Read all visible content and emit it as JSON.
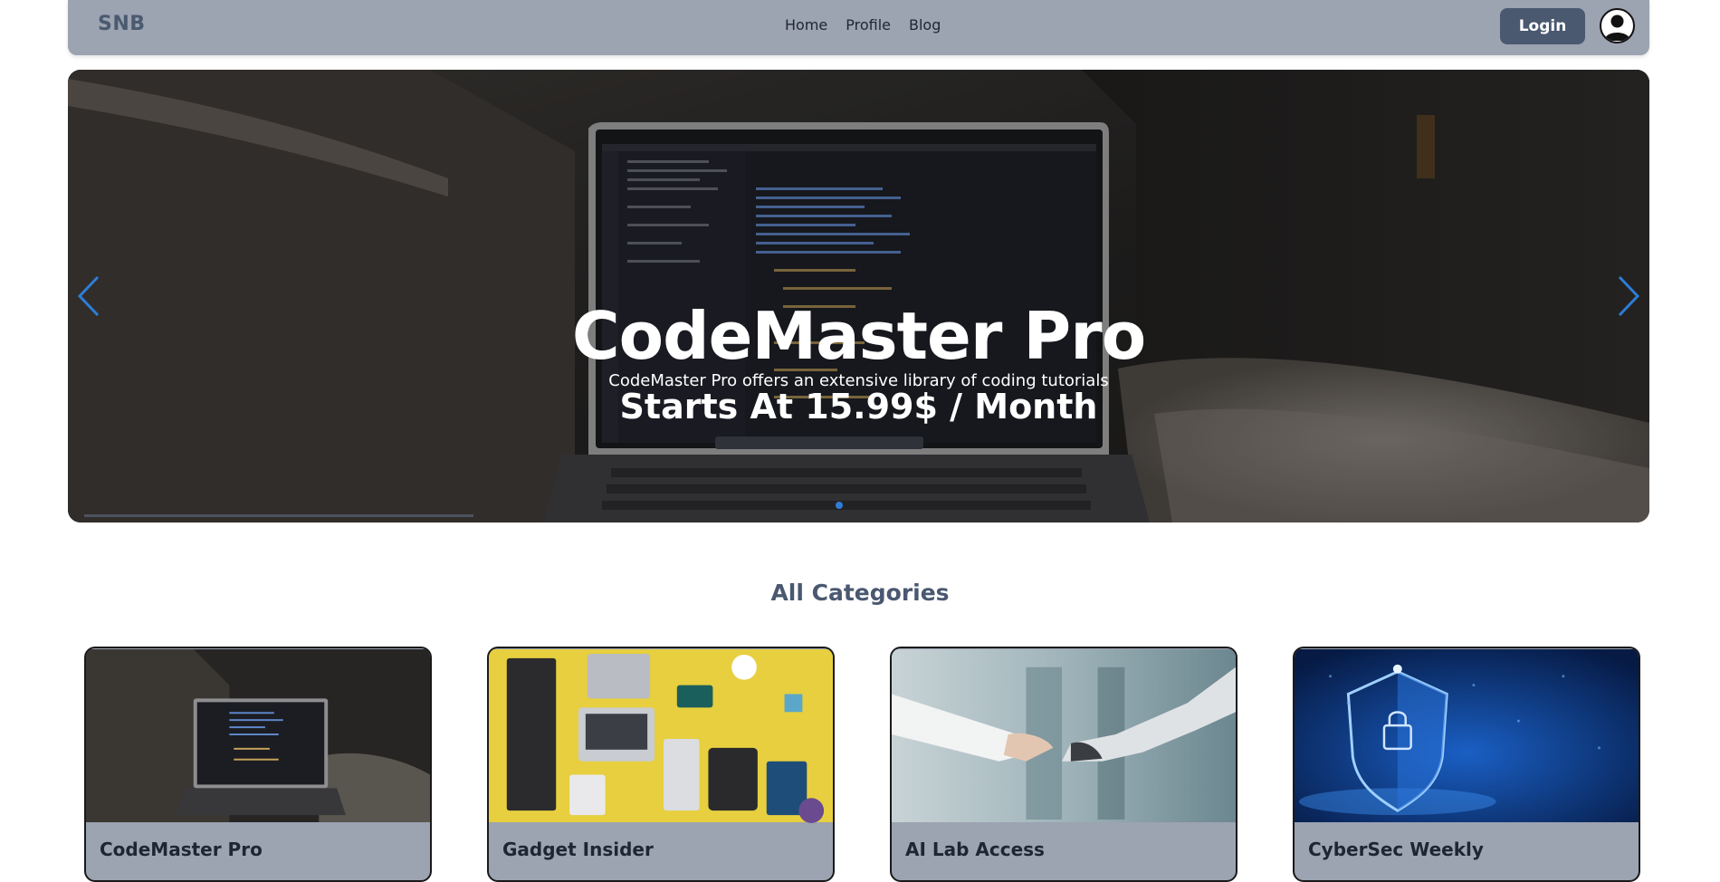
{
  "navbar": {
    "brand": "SNB",
    "links": [
      "Home",
      "Profile",
      "Blog"
    ],
    "login_label": "Login"
  },
  "hero": {
    "title": "CodeMaster Pro",
    "subtitle": "CodeMaster Pro offers an extensive library of coding tutorials",
    "price": "Starts At 15.99$ / Month",
    "slide_count": 1,
    "active_slide": 1
  },
  "categories": {
    "title": "All Categories",
    "items": [
      {
        "name": "CodeMaster Pro"
      },
      {
        "name": "Gadget Insider"
      },
      {
        "name": "AI Lab Access"
      },
      {
        "name": "CyberSec Weekly"
      }
    ]
  },
  "colors": {
    "navbar_bg": "#9ca3b1",
    "brand": "#4b5a70",
    "login_bg": "#4a5870",
    "accent_blue": "#2d7dd8"
  }
}
